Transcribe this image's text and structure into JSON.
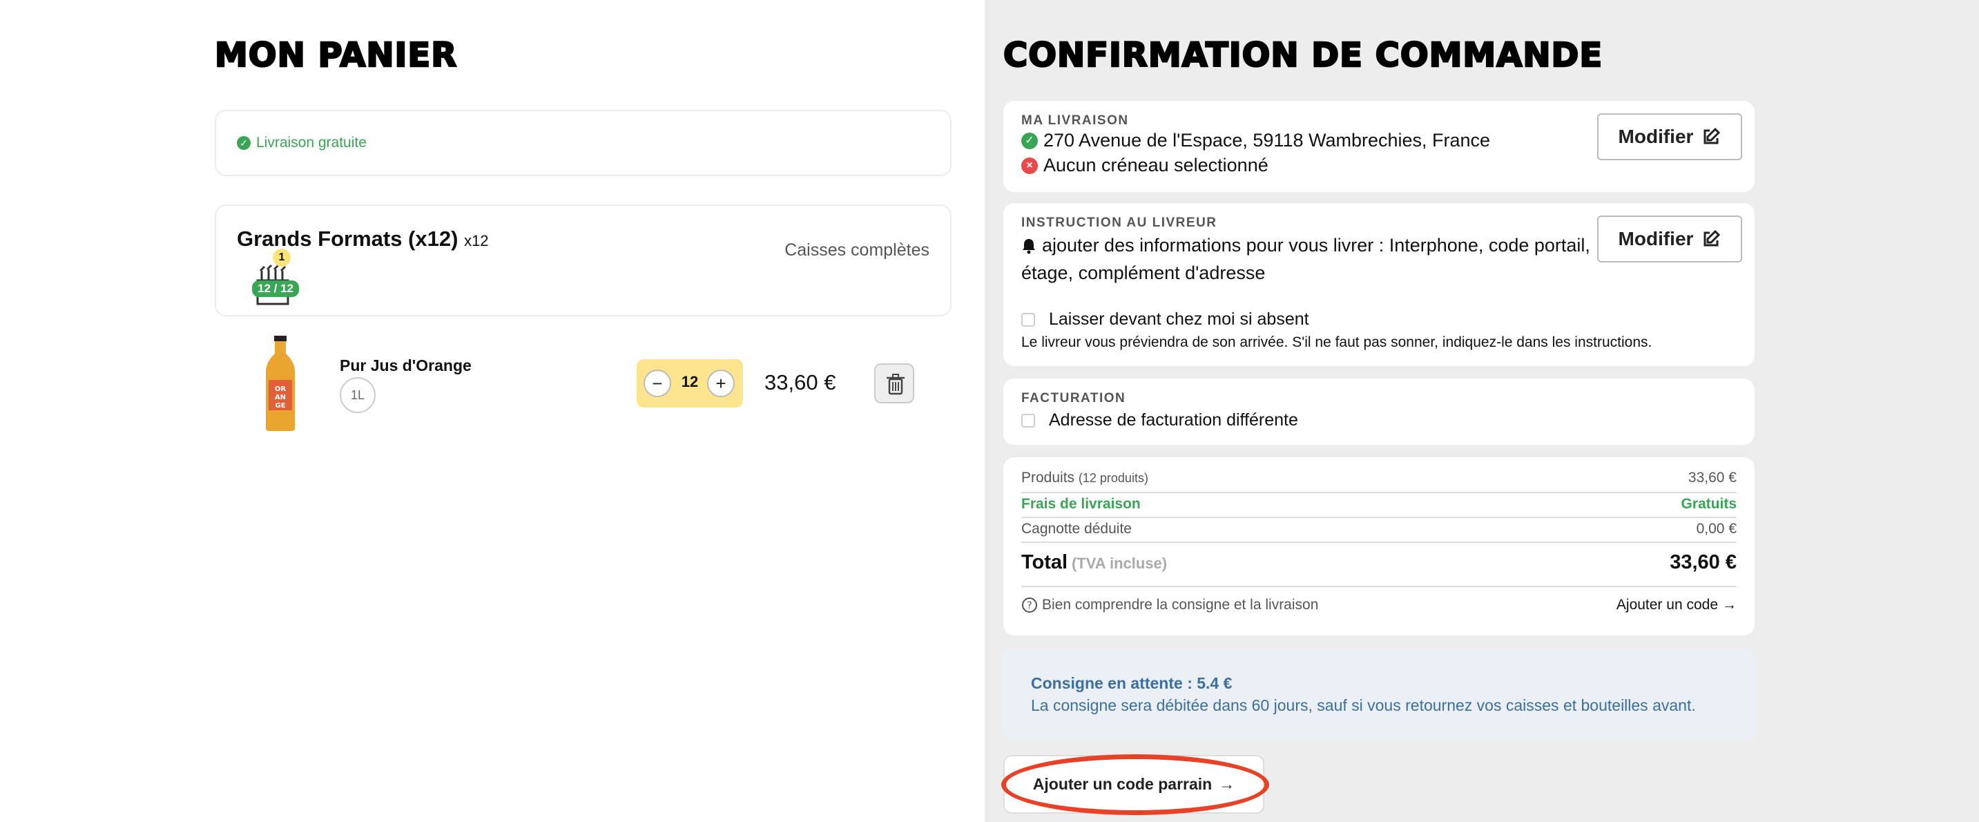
{
  "left": {
    "title": "MON PANIER",
    "free_shipping": "Livraison gratuite",
    "box": {
      "title": "Grands Formats (x12)",
      "multiplier": "x12",
      "status": "Caisses complètes",
      "badge_count": "1",
      "fill": "12 / 12"
    },
    "product": {
      "name": "Pur Jus d'Orange",
      "size": "1L",
      "qty": "12",
      "minus": "−",
      "plus": "+",
      "price": "33,60 €"
    }
  },
  "right": {
    "title": "CONFIRMATION DE COMMANDE",
    "delivery": {
      "label": "MA LIVRAISON",
      "address": "270 Avenue de l'Espace, 59118 Wambrechies, France",
      "slot": "Aucun créneau selectionné",
      "edit": "Modifier"
    },
    "instruction": {
      "label": "INSTRUCTION AU LIVREUR",
      "text1": "ajouter des informations pour vous livrer : Interphone, code portail,",
      "text2": "étage, complément d'adresse",
      "edit": "Modifier",
      "checkbox_label": "Laisser devant chez moi si absent",
      "note": "Le livreur vous préviendra de son arrivée. S'il ne faut pas sonner, indiquez-le dans les instructions."
    },
    "billing": {
      "label": "FACTURATION",
      "checkbox_label": "Adresse de facturation différente"
    },
    "summary": {
      "products_label": "Produits",
      "products_count": "(12 produits)",
      "products_value": "33,60 €",
      "shipping_label": "Frais de livraison",
      "shipping_value": "Gratuits",
      "jackpot_label": "Cagnotte déduite",
      "jackpot_value": "0,00 €",
      "total_label": "Total",
      "total_tax": "(TVA incluse)",
      "total_value": "33,60 €",
      "help": "Bien comprendre la consigne et la livraison",
      "add_code": "Ajouter un code"
    },
    "consigne": {
      "title": "Consigne en attente : 5.4 €",
      "text": "La consigne sera débitée dans 60 jours, sauf si vous retournez vos caisses et bouteilles avant."
    },
    "referral": "Ajouter un code parrain"
  },
  "colors": {
    "green": "#3aa655",
    "red": "#e8494c",
    "yellow": "#fce58e",
    "blue": "#3c6ea0",
    "highlight": "#e84126"
  }
}
